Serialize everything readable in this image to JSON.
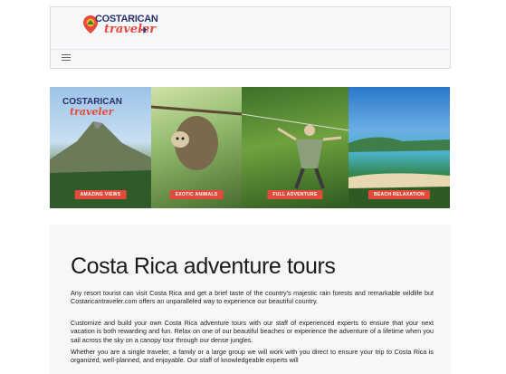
{
  "header": {
    "logo_line1": "COSTARICAN",
    "logo_line2": "traveler"
  },
  "banner": {
    "logo_line1": "COSTARICAN",
    "logo_line2": "traveler",
    "panels": [
      {
        "caption": "AMAZING VIEWS"
      },
      {
        "caption": "EXOTIC ANIMALS"
      },
      {
        "caption": "FULL ADVENTURE"
      },
      {
        "caption": "BEACH RELAXATION"
      }
    ]
  },
  "main": {
    "title": "Costa Rica adventure tours",
    "paragraphs": [
      "Any resort tourist can visit Costa Rica and get a brief taste of the country's majestic rain forests and remarkable wildlife but Costaricantraveler.com offers an unparalleled way to experience our beautiful country.",
      "Customize and build your own Costa Rica adventure tours with our staff of experienced experts to ensure that your next vacation is both rewarding and fun. Relax on one of our beautiful beaches or experience the adventure of a lifetime when you sail across the sky on a canopy tour through our dense jungles.",
      "Whether you are a single traveler, a family or a large group we will work with you direct to ensure your trip to Costa Rica is organized, well-planned, and enjoyable. Our staff of knowledgeable experts will"
    ]
  },
  "colors": {
    "brand_navy": "#2b2f6b",
    "brand_red": "#e8483b",
    "caption_red": "#e24a3b"
  }
}
